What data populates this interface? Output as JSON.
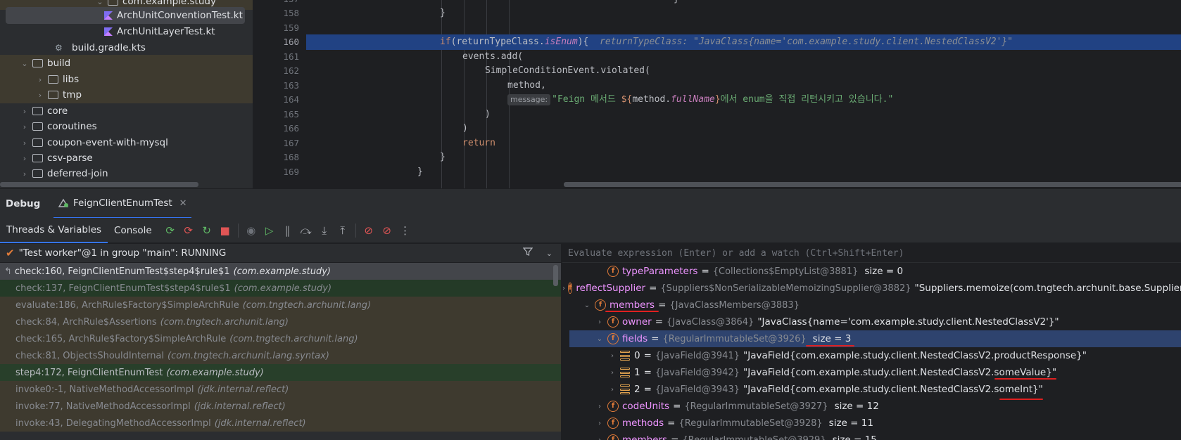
{
  "tree": {
    "items": [
      {
        "label": "com.example.study",
        "icon": "package-icon",
        "indent": 135,
        "chevron": "expanded",
        "build": true
      },
      {
        "label": "ArchUnitConventionTest.kt",
        "icon": "kotlin-file-icon",
        "indent": 130,
        "selected": true
      },
      {
        "label": "ArchUnitLayerTest.kt",
        "icon": "kotlin-file-icon",
        "indent": 130
      },
      {
        "label": "build.gradle.kts",
        "icon": "gradle-icon",
        "indent": 60
      },
      {
        "label": "build",
        "icon": "folder-icon",
        "indent": 28,
        "chevron": "expanded",
        "build": true
      },
      {
        "label": "libs",
        "icon": "folder-icon",
        "indent": 50,
        "chevron": "collapsed",
        "build": true
      },
      {
        "label": "tmp",
        "icon": "folder-icon",
        "indent": 50,
        "chevron": "collapsed",
        "build": true
      },
      {
        "label": "core",
        "icon": "folder-icon",
        "indent": 28,
        "chevron": "collapsed"
      },
      {
        "label": "coroutines",
        "icon": "folder-icon",
        "indent": 28,
        "chevron": "collapsed"
      },
      {
        "label": "coupon-event-with-mysql",
        "icon": "folder-icon",
        "indent": 28,
        "chevron": "collapsed"
      },
      {
        "label": "csv-parse",
        "icon": "folder-icon",
        "indent": 28,
        "chevron": "collapsed"
      },
      {
        "label": "deferred-join",
        "icon": "folder-icon",
        "indent": 28,
        "chevron": "collapsed"
      }
    ]
  },
  "editor": {
    "lines": [
      {
        "num": "157",
        "html": "<span style=\"padding-left:522px\">}</span>"
      },
      {
        "num": "158",
        "html": "<span style=\"padding-left:190px\">}</span>"
      },
      {
        "num": "159",
        "html": ""
      },
      {
        "num": "160",
        "current": true,
        "html": "<span style=\"padding-left:190px\"><span class=\"kw\">if</span>(returnTypeClass.<span class=\"it\">isEnum</span>){  <span class=\"inl\">returnTypeClass: \"JavaClass{name='com.example.study.client.NestedClassV2'}\"</span></span>"
      },
      {
        "num": "161",
        "html": "<span style=\"padding-left:222px\">events.add(</span>"
      },
      {
        "num": "162",
        "html": "<span style=\"padding-left:254px\">SimpleConditionEvent.violated(</span>"
      },
      {
        "num": "163",
        "html": "<span style=\"padding-left:286px\">method,</span>"
      },
      {
        "num": "164",
        "html": "<span style=\"padding-left:286px\"><span class=\"hintbox\">message:</span><span class=\"str\">\"Feign 메서드 </span><span class=\"kw\">${</span>method.<span class=\"fn\">fullName</span><span class=\"kw\">}</span><span class=\"str\">에서 enum을 직접 리턴시키고 있습니다.\"</span></span>"
      },
      {
        "num": "165",
        "html": "<span style=\"padding-left:254px\">)</span>"
      },
      {
        "num": "166",
        "html": "<span style=\"padding-left:222px\">)</span>"
      },
      {
        "num": "167",
        "html": "<span style=\"padding-left:222px\"><span class=\"kw\">return</span></span>"
      },
      {
        "num": "168",
        "html": "<span style=\"padding-left:190px\">}</span>"
      },
      {
        "num": "169",
        "html": "<span style=\"padding-left:158px\">}</span>"
      }
    ]
  },
  "debug": {
    "title": "Debug",
    "tab_label": "FeignClientEnumTest",
    "views": [
      "Threads & Variables",
      "Console"
    ],
    "toolbar_icons": [
      "rerun-icon",
      "rerun-failed-icon",
      "restart-icon",
      "stop-icon",
      "|",
      "mute-breakpoints-icon",
      "resume-icon",
      "pause-icon",
      "step-over-icon",
      "step-into-icon",
      "step-out-icon",
      "|",
      "view-breakpoints-icon",
      "mute-icon",
      "more-icon"
    ],
    "thread": "\"Test worker\"@1 in group \"main\": RUNNING",
    "frames": [
      {
        "method": "check:160, FeignClientEnumTest$step4$rule$1",
        "pkg": "(com.example.study)",
        "kind": "sel"
      },
      {
        "method": "check:137, FeignClientEnumTest$step4$rule$1",
        "pkg": "(com.example.study)",
        "kind": "proj"
      },
      {
        "method": "evaluate:186, ArchRule$Factory$SimpleArchRule",
        "pkg": "(com.tngtech.archunit.lang)",
        "kind": "lib"
      },
      {
        "method": "check:84, ArchRule$Assertions",
        "pkg": "(com.tngtech.archunit.lang)",
        "kind": "lib"
      },
      {
        "method": "check:165, ArchRule$Factory$SimpleArchRule",
        "pkg": "(com.tngtech.archunit.lang)",
        "kind": "lib"
      },
      {
        "method": "check:81, ObjectsShouldInternal",
        "pkg": "(com.tngtech.archunit.lang.syntax)",
        "kind": "lib"
      },
      {
        "method": "step4:172, FeignClientEnumTest",
        "pkg": "(com.example.study)",
        "kind": "proj2"
      },
      {
        "method": "invoke0:-1, NativeMethodAccessorImpl",
        "pkg": "(jdk.internal.reflect)",
        "kind": "lib"
      },
      {
        "method": "invoke:77, NativeMethodAccessorImpl",
        "pkg": "(jdk.internal.reflect)",
        "kind": "lib"
      },
      {
        "method": "invoke:43, DelegatingMethodAccessorImpl",
        "pkg": "(jdk.internal.reflect)",
        "kind": "lib"
      }
    ],
    "eval_placeholder": "Evaluate expression (Enter) or add a watch (Ctrl+Shift+Enter)",
    "vars": [
      {
        "level": 2,
        "chev": "",
        "icon": "field",
        "name": "typeParameters",
        "type": "{Collections$EmptyList@3881}",
        "size": "size = 0"
      },
      {
        "level": 1,
        "chev": "collapsed",
        "icon": "field",
        "name": "reflectSupplier",
        "type": "{Suppliers$NonSerializableMemoizingSupplier@3882}",
        "value": "\"Suppliers.memoize(com.tngtech.archunit.base.Suppliers$"
      },
      {
        "level": 1,
        "chev": "expanded",
        "icon": "field",
        "name": "members",
        "type": "{JavaClassMembers@3883}",
        "underline": true
      },
      {
        "level": 2,
        "chev": "collapsed",
        "icon": "field",
        "name": "owner",
        "type": "{JavaClass@3864}",
        "value": "\"JavaClass{name='com.example.study.client.NestedClassV2'}\""
      },
      {
        "level": 2,
        "chev": "expanded",
        "icon": "field",
        "name": "fields",
        "type": "{RegularImmutableSet@3926}",
        "size": "size = 3",
        "selected": true
      },
      {
        "level": 3,
        "chev": "collapsed",
        "icon": "array",
        "name": "0",
        "type": "{JavaField@3941}",
        "value": "\"JavaField{com.example.study.client.NestedClassV2.productResponse}\""
      },
      {
        "level": 3,
        "chev": "collapsed",
        "icon": "array",
        "name": "1",
        "type": "{JavaField@3942}",
        "value": "\"JavaField{com.example.study.client.NestedClassV2.someValue}\""
      },
      {
        "level": 3,
        "chev": "collapsed",
        "icon": "array",
        "name": "2",
        "type": "{JavaField@3943}",
        "value": "\"JavaField{com.example.study.client.NestedClassV2.someInt}\""
      },
      {
        "level": 2,
        "chev": "collapsed",
        "icon": "field",
        "name": "codeUnits",
        "type": "{RegularImmutableSet@3927}",
        "size": "size = 12"
      },
      {
        "level": 2,
        "chev": "collapsed",
        "icon": "field",
        "name": "methods",
        "type": "{RegularImmutableSet@3928}",
        "size": "size = 11"
      },
      {
        "level": 2,
        "chev": "collapsed",
        "icon": "field",
        "name": "members",
        "type": "{RegularImmutableSet@3929}",
        "size": "size = 15"
      }
    ]
  },
  "colors": {
    "accent": "#3574f0",
    "current_line": "#214283",
    "annotation_red": "#e02020",
    "field_name": "#ed94ff"
  }
}
